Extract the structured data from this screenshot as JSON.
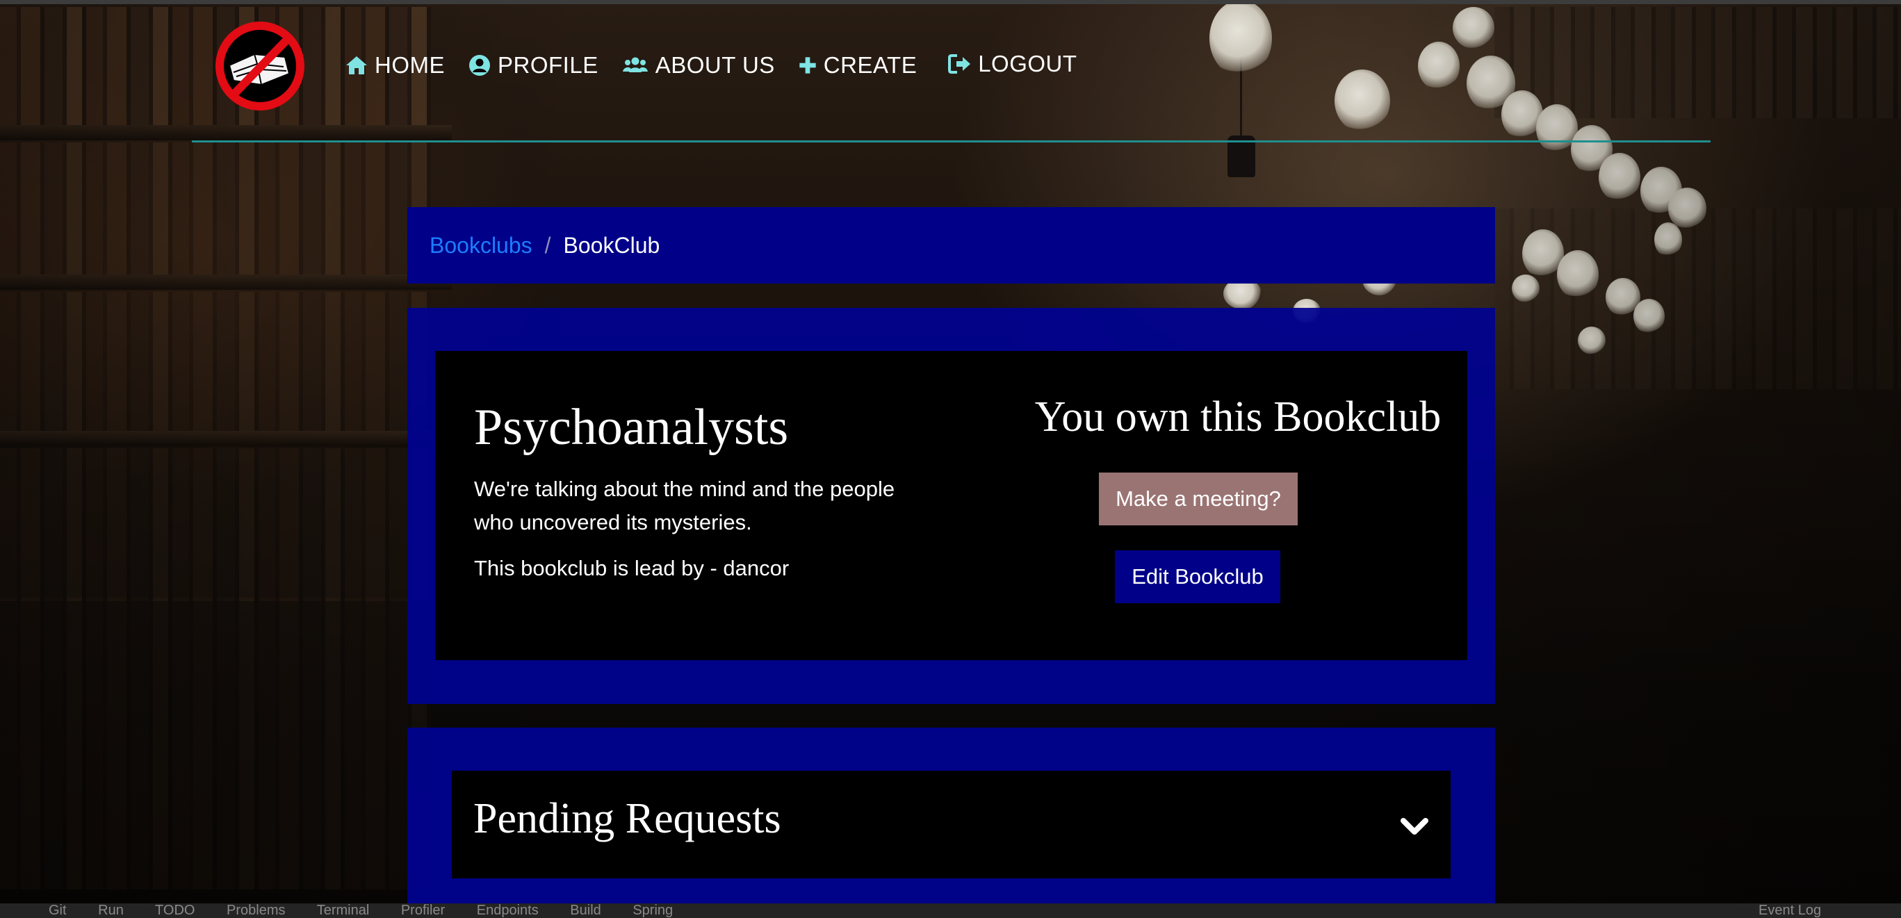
{
  "nav": {
    "items": [
      {
        "label": "HOME",
        "icon": "home-icon"
      },
      {
        "label": "PROFILE",
        "icon": "user-circle-icon"
      },
      {
        "label": "ABOUT US",
        "icon": "users-icon"
      },
      {
        "label": "CREATE",
        "icon": "plus-icon"
      },
      {
        "label": "LOGOUT",
        "icon": "sign-out-icon"
      }
    ],
    "logo": "no-books-logo",
    "icon_color": "#7fe3e3",
    "rule_color": "#1f8f8f"
  },
  "breadcrumb": {
    "link": "Bookclubs",
    "separator": "/",
    "current": "BookClub"
  },
  "club": {
    "title": "Psychoanalysts",
    "description": "We're talking about the mind and the people who uncovered its mysteries.",
    "lead": "This bookclub is lead by - dancor",
    "owner_heading": "You own this Bookclub",
    "meeting_button": "Make a meeting?",
    "edit_button": "Edit Bookclub"
  },
  "pending": {
    "title": "Pending Requests",
    "toggle_icon": "chevron-down-icon"
  },
  "colors": {
    "panel": "#000188",
    "meeting_button": "#9a7473",
    "link": "#1e7cff"
  },
  "ide_bar": [
    "Git",
    "Run",
    "TODO",
    "Problems",
    "Terminal",
    "Profiler",
    "Endpoints",
    "Build",
    "Spring",
    "Event Log"
  ]
}
